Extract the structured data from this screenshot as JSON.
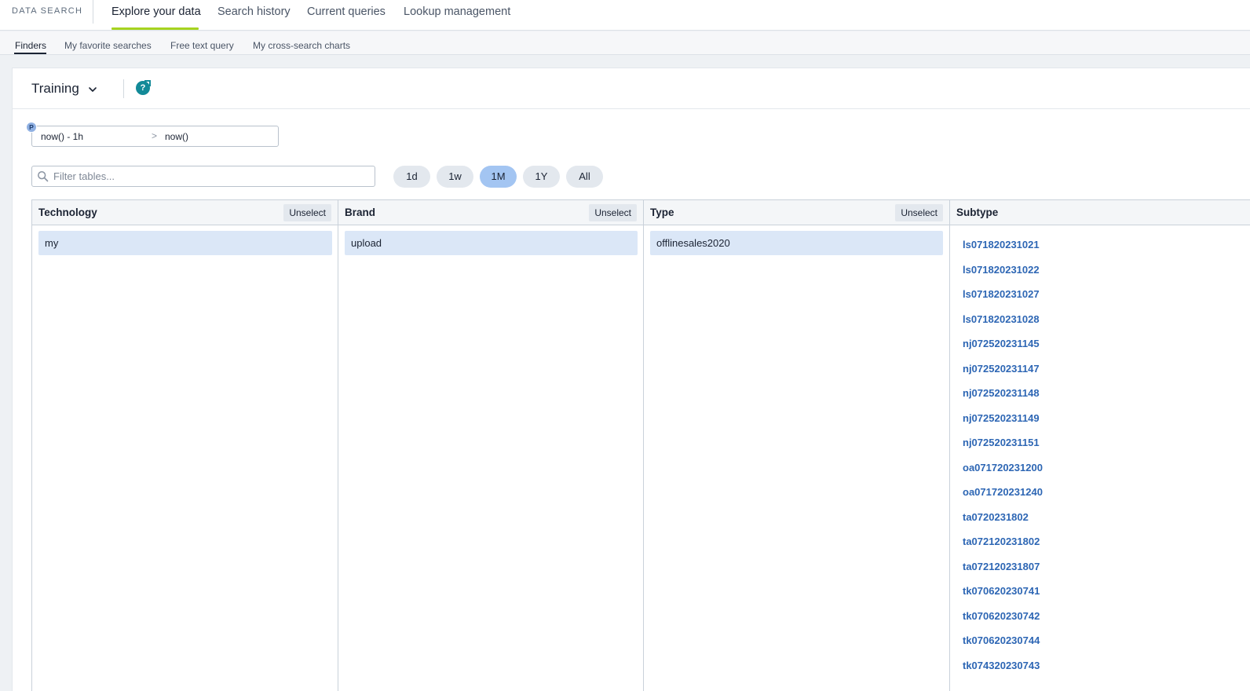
{
  "nav": {
    "brand": "DATA SEARCH",
    "tabs": [
      {
        "label": "Explore your data",
        "active": true
      },
      {
        "label": "Search history"
      },
      {
        "label": "Current queries"
      },
      {
        "label": "Lookup management"
      }
    ]
  },
  "subnav": {
    "tabs": [
      {
        "label": "Finders",
        "active": true
      },
      {
        "label": "My favorite searches"
      },
      {
        "label": "Free text query"
      },
      {
        "label": "My cross-search charts"
      }
    ]
  },
  "header": {
    "title": "Training",
    "title_icon": "chevron-down-icon",
    "help_glyph": "?",
    "help_icon": "help-icon"
  },
  "timeframe": {
    "badge": "P",
    "from": "now() - 1h",
    "separator": ">",
    "to": "now()"
  },
  "filter": {
    "placeholder": "Filter tables...",
    "value": "",
    "icon": "search-icon"
  },
  "periods": [
    {
      "label": "1d"
    },
    {
      "label": "1w"
    },
    {
      "label": "1M",
      "active": true
    },
    {
      "label": "1Y"
    },
    {
      "label": "All"
    }
  ],
  "columns": [
    {
      "title": "Technology",
      "unselect": "Unselect",
      "selected": "my"
    },
    {
      "title": "Brand",
      "unselect": "Unselect",
      "selected": "upload"
    },
    {
      "title": "Type",
      "unselect": "Unselect",
      "selected": "offlinesales2020"
    },
    {
      "title": "Subtype",
      "items": [
        "ls071820231021",
        "ls071820231022",
        "ls071820231027",
        "ls071820231028",
        "nj072520231145",
        "nj072520231147",
        "nj072520231148",
        "nj072520231149",
        "nj072520231151",
        "oa071720231200",
        "oa071720231240",
        "ta0720231802",
        "ta072120231802",
        "ta072120231807",
        "tk070620230741",
        "tk070620230742",
        "tk070620230744",
        "tk074320230743"
      ]
    }
  ],
  "colors": {
    "accent_underline": "#a6d31f",
    "link": "#2d66b4",
    "selected_row": "#dbe7f7",
    "active_pill": "#a3c5f2",
    "help": "#138a98"
  }
}
